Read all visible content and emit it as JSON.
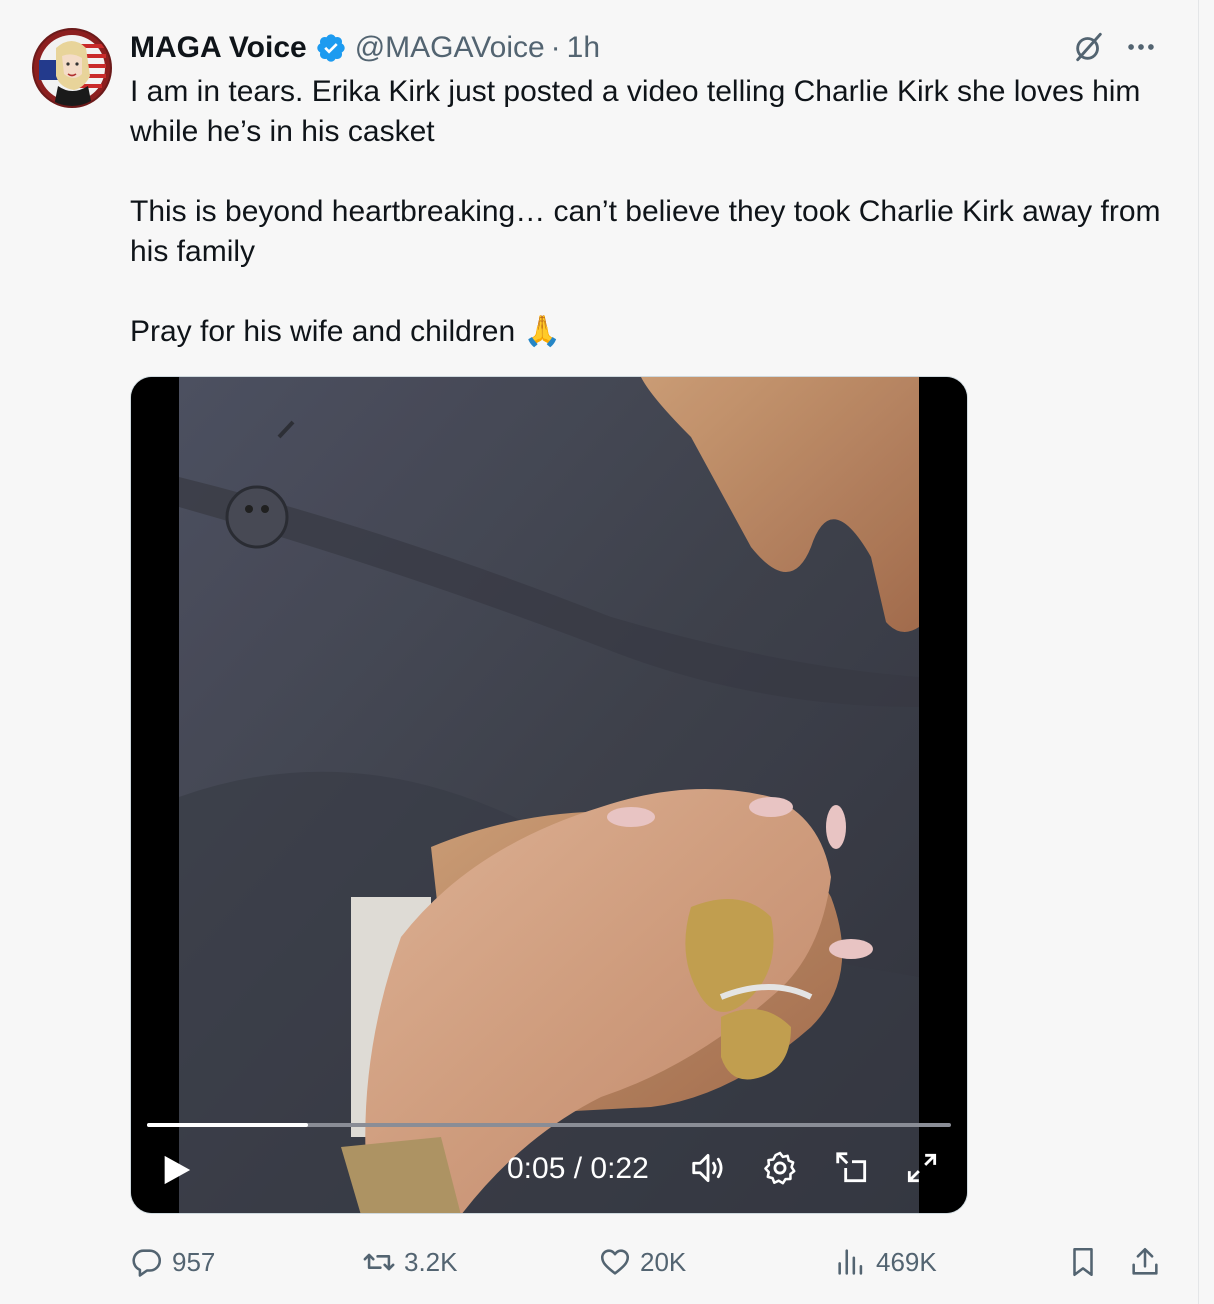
{
  "author": {
    "display_name": "MAGA Voice",
    "handle": "@MAGAVoice",
    "separator": "·",
    "time": "1h",
    "verified": true
  },
  "tweet": {
    "paragraph1": "I am in tears. Erika Kirk just posted a video telling Charlie Kirk she loves him while he’s in his casket",
    "paragraph2": "This is beyond heartbreaking… can’t believe they took Charlie Kirk away from his family",
    "paragraph3": "Pray for his wife and children",
    "emoji": "🙏"
  },
  "video": {
    "current_time": "0:05",
    "duration": "0:22",
    "time_display": "0:05 / 0:22",
    "progress_fraction": 0.2
  },
  "actions": {
    "replies": "957",
    "reposts": "3.2K",
    "likes": "20K",
    "views": "469K"
  },
  "icons": {
    "verified": "verified-badge-icon",
    "grok": "grok-icon",
    "more": "more-icon",
    "reply": "reply-icon",
    "repost": "repost-icon",
    "like": "like-icon",
    "views": "views-icon",
    "bookmark": "bookmark-icon",
    "share": "share-icon"
  },
  "colors": {
    "verified_blue": "#1d9bf0",
    "secondary_text": "#536471",
    "primary_text": "#0f1419"
  }
}
